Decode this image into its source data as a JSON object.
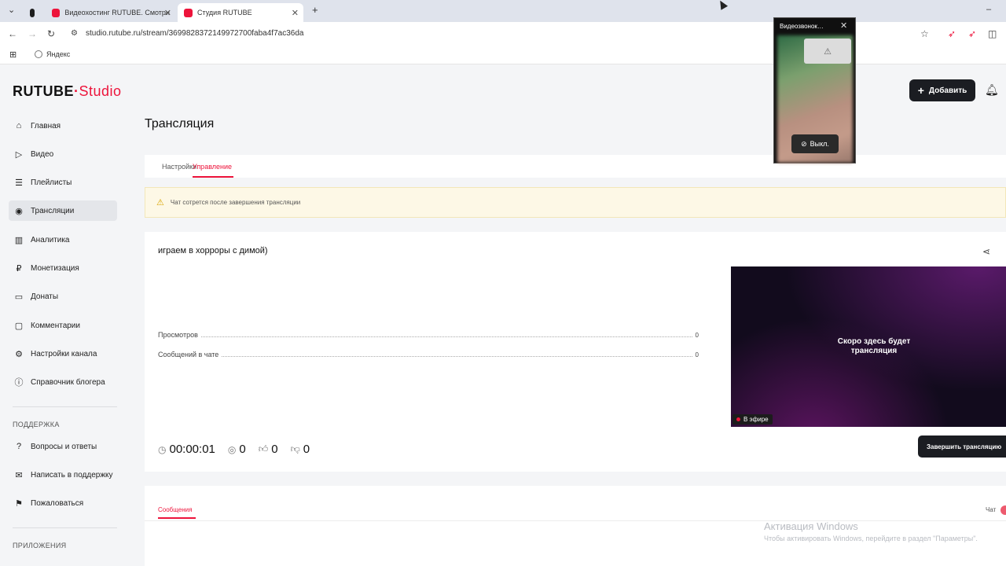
{
  "browser": {
    "tabs": [
      {
        "title": "",
        "fav_color": "#1d1d1d"
      },
      {
        "title": "Видеохостинг RUTUBE. Смотри…",
        "fav_color": "#ed143b"
      },
      {
        "title": "Студия RUTUBE",
        "fav_color": "#ed143b"
      }
    ],
    "url": "studio.rutube.ru/stream/3699828372149972700faba4f7ac36da",
    "bookmark": "Яндекс"
  },
  "app": {
    "logo_main": "RUTUBE",
    "logo_sub": "Studio",
    "page_title": "Трансляция",
    "add_label": "Добавить"
  },
  "sidebar": {
    "items": [
      {
        "label": "Главная",
        "icon": "home-icon"
      },
      {
        "label": "Видео",
        "icon": "video-icon"
      },
      {
        "label": "Плейлисты",
        "icon": "playlist-icon"
      },
      {
        "label": "Трансляции",
        "icon": "broadcast-icon",
        "active": true
      },
      {
        "label": "Аналитика",
        "icon": "analytics-icon"
      },
      {
        "label": "Монетизация",
        "icon": "ruble-icon"
      },
      {
        "label": "Донаты",
        "icon": "wallet-icon"
      },
      {
        "label": "Комментарии",
        "icon": "comment-icon"
      },
      {
        "label": "Настройки канала",
        "icon": "gear-icon"
      },
      {
        "label": "Справочник блогера",
        "icon": "info-icon"
      }
    ],
    "support_label": "ПОДДЕРЖКА",
    "support_items": [
      {
        "label": "Вопросы и ответы",
        "icon": "help-icon"
      },
      {
        "label": "Написать в поддержку",
        "icon": "mail-icon"
      },
      {
        "label": "Пожаловаться",
        "icon": "flag-icon"
      }
    ],
    "apps_label": "ПРИЛОЖЕНИЯ"
  },
  "tabs": {
    "settings": "Настройки",
    "manage": "Управление"
  },
  "warning": "Чат сотрется после завершения трансляции",
  "stream": {
    "title": "играем в хорроры с димой)",
    "views_label": "Просмотров",
    "views_value": "0",
    "messages_label": "Сообщений в чате",
    "messages_value": "0",
    "timer": "00:00:01",
    "viewers": "0",
    "likes": "0",
    "dislikes": "0",
    "preview_text_1": "Скоро здесь будет",
    "preview_text_2": "трансляция",
    "live_label": "В эфире",
    "end_label": "Завершить трансляцию"
  },
  "chat": {
    "messages_tab": "Сообщения",
    "chat_label": "Чат"
  },
  "activation": {
    "line1": "Активация Windows",
    "line2": "Чтобы активировать Windows, перейдите в раздел \"Параметры\"."
  },
  "videocall": {
    "title": "Видеозвонок…",
    "off_label": "Выкл."
  }
}
